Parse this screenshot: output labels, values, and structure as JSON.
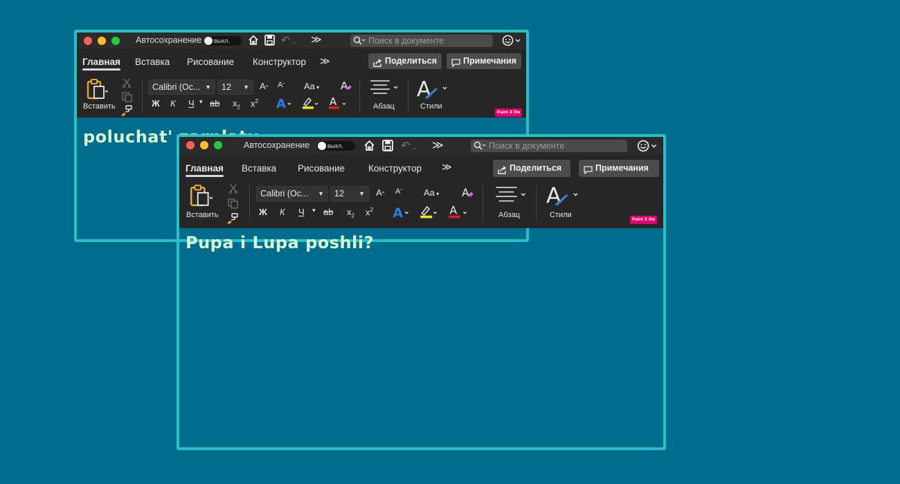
{
  "autosave": {
    "label": "Автосохранение",
    "toggle": "выкл."
  },
  "search": {
    "placeholder": "Поиск в документе"
  },
  "tabs": [
    "Главная",
    "Вставка",
    "Рисование",
    "Конструктор"
  ],
  "more": "≫",
  "share": "Поделиться",
  "comments": "Примечания",
  "ribbon": {
    "paste": "Вставить",
    "font": "Calibri (Ос...",
    "size": "12",
    "grow": "A",
    "shrink": "A",
    "case": "Aa",
    "bold": "Ж",
    "italic": "К",
    "underline": "Ч",
    "strike": "ab",
    "sub": "x",
    "sup": "x",
    "paragraph": "Абзац",
    "styles": "Стили"
  },
  "badge": "Paint X lite",
  "documents": [
    {
      "text": "poluchat'  zarplatu"
    },
    {
      "text": "Pupa  i  Lupa  poshli?"
    }
  ],
  "colors": {
    "background": "#006d8f",
    "frame": "#27c1c6",
    "chrome": "#262626",
    "text": "#d8f3ce",
    "badge": "#e6006e"
  }
}
